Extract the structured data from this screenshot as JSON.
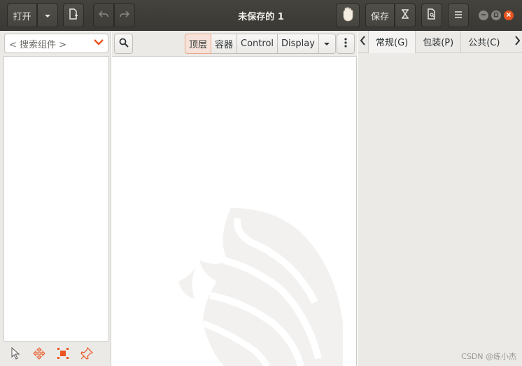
{
  "header": {
    "open_label": "打开",
    "save_label": "保存",
    "title": "未保存的 1"
  },
  "left": {
    "search_placeholder": "< 搜索组件 >"
  },
  "center": {
    "segments": [
      "顶层",
      "容器",
      "Control",
      "Display"
    ]
  },
  "right": {
    "tabs": [
      "常规(G)",
      "包装(P)",
      "公共(C)"
    ]
  },
  "watermark": "CSDN @练小杰",
  "colors": {
    "accent": "#e95420",
    "headerbar": "#3f3e39"
  }
}
